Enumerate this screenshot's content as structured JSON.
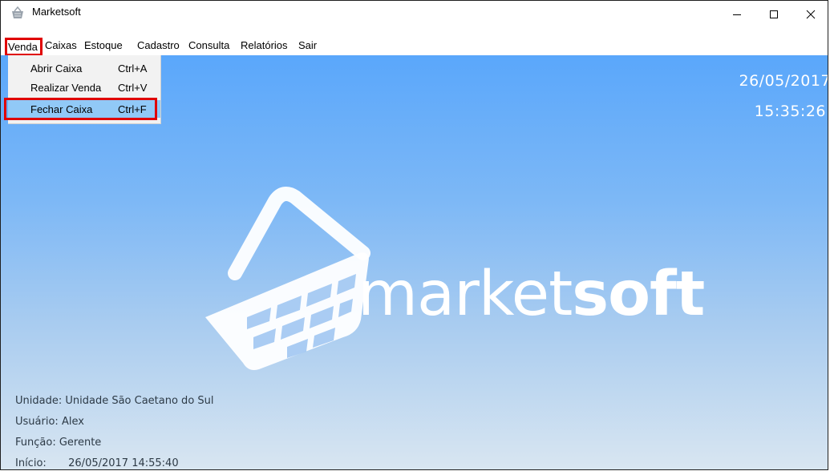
{
  "window": {
    "title": "Marketsoft",
    "icon": "basket-app-icon",
    "controls": {
      "minimize": "minimize-icon",
      "maximize": "maximize-icon",
      "close": "close-icon"
    }
  },
  "menubar": {
    "items": [
      {
        "label": "Venda",
        "highlighted": true
      },
      {
        "label": "Caixas"
      },
      {
        "label": "Estoque"
      },
      {
        "label": "Cadastro"
      },
      {
        "label": "Consulta"
      },
      {
        "label": "Relatórios"
      },
      {
        "label": "Sair"
      }
    ]
  },
  "dropdown": {
    "items": [
      {
        "label": "Abrir Caixa",
        "shortcut": "Ctrl+A"
      },
      {
        "label": "Realizar Venda",
        "shortcut": "Ctrl+V"
      },
      {
        "label": "Fechar Caixa",
        "shortcut": "Ctrl+F",
        "selected": true,
        "highlighted": true
      }
    ]
  },
  "clock": {
    "date": "26/05/2017",
    "time": "15:35:26"
  },
  "logo": {
    "text_regular": "market",
    "text_bold": "soft"
  },
  "info": {
    "unidade": {
      "label": "Unidade:",
      "value": "Unidade São Caetano do Sul"
    },
    "usuario": {
      "label": "Usuário:",
      "value": "Alex"
    },
    "funcao": {
      "label": "Função:",
      "value": "Gerente"
    },
    "inicio": {
      "label": "Início:",
      "value": "26/05/2017 14:55:40"
    }
  },
  "colors": {
    "highlight_outline": "#e00000",
    "menu_selection": "#91c9f7",
    "background_top": "#5aa7fb",
    "background_bottom": "#d9e6f1"
  }
}
